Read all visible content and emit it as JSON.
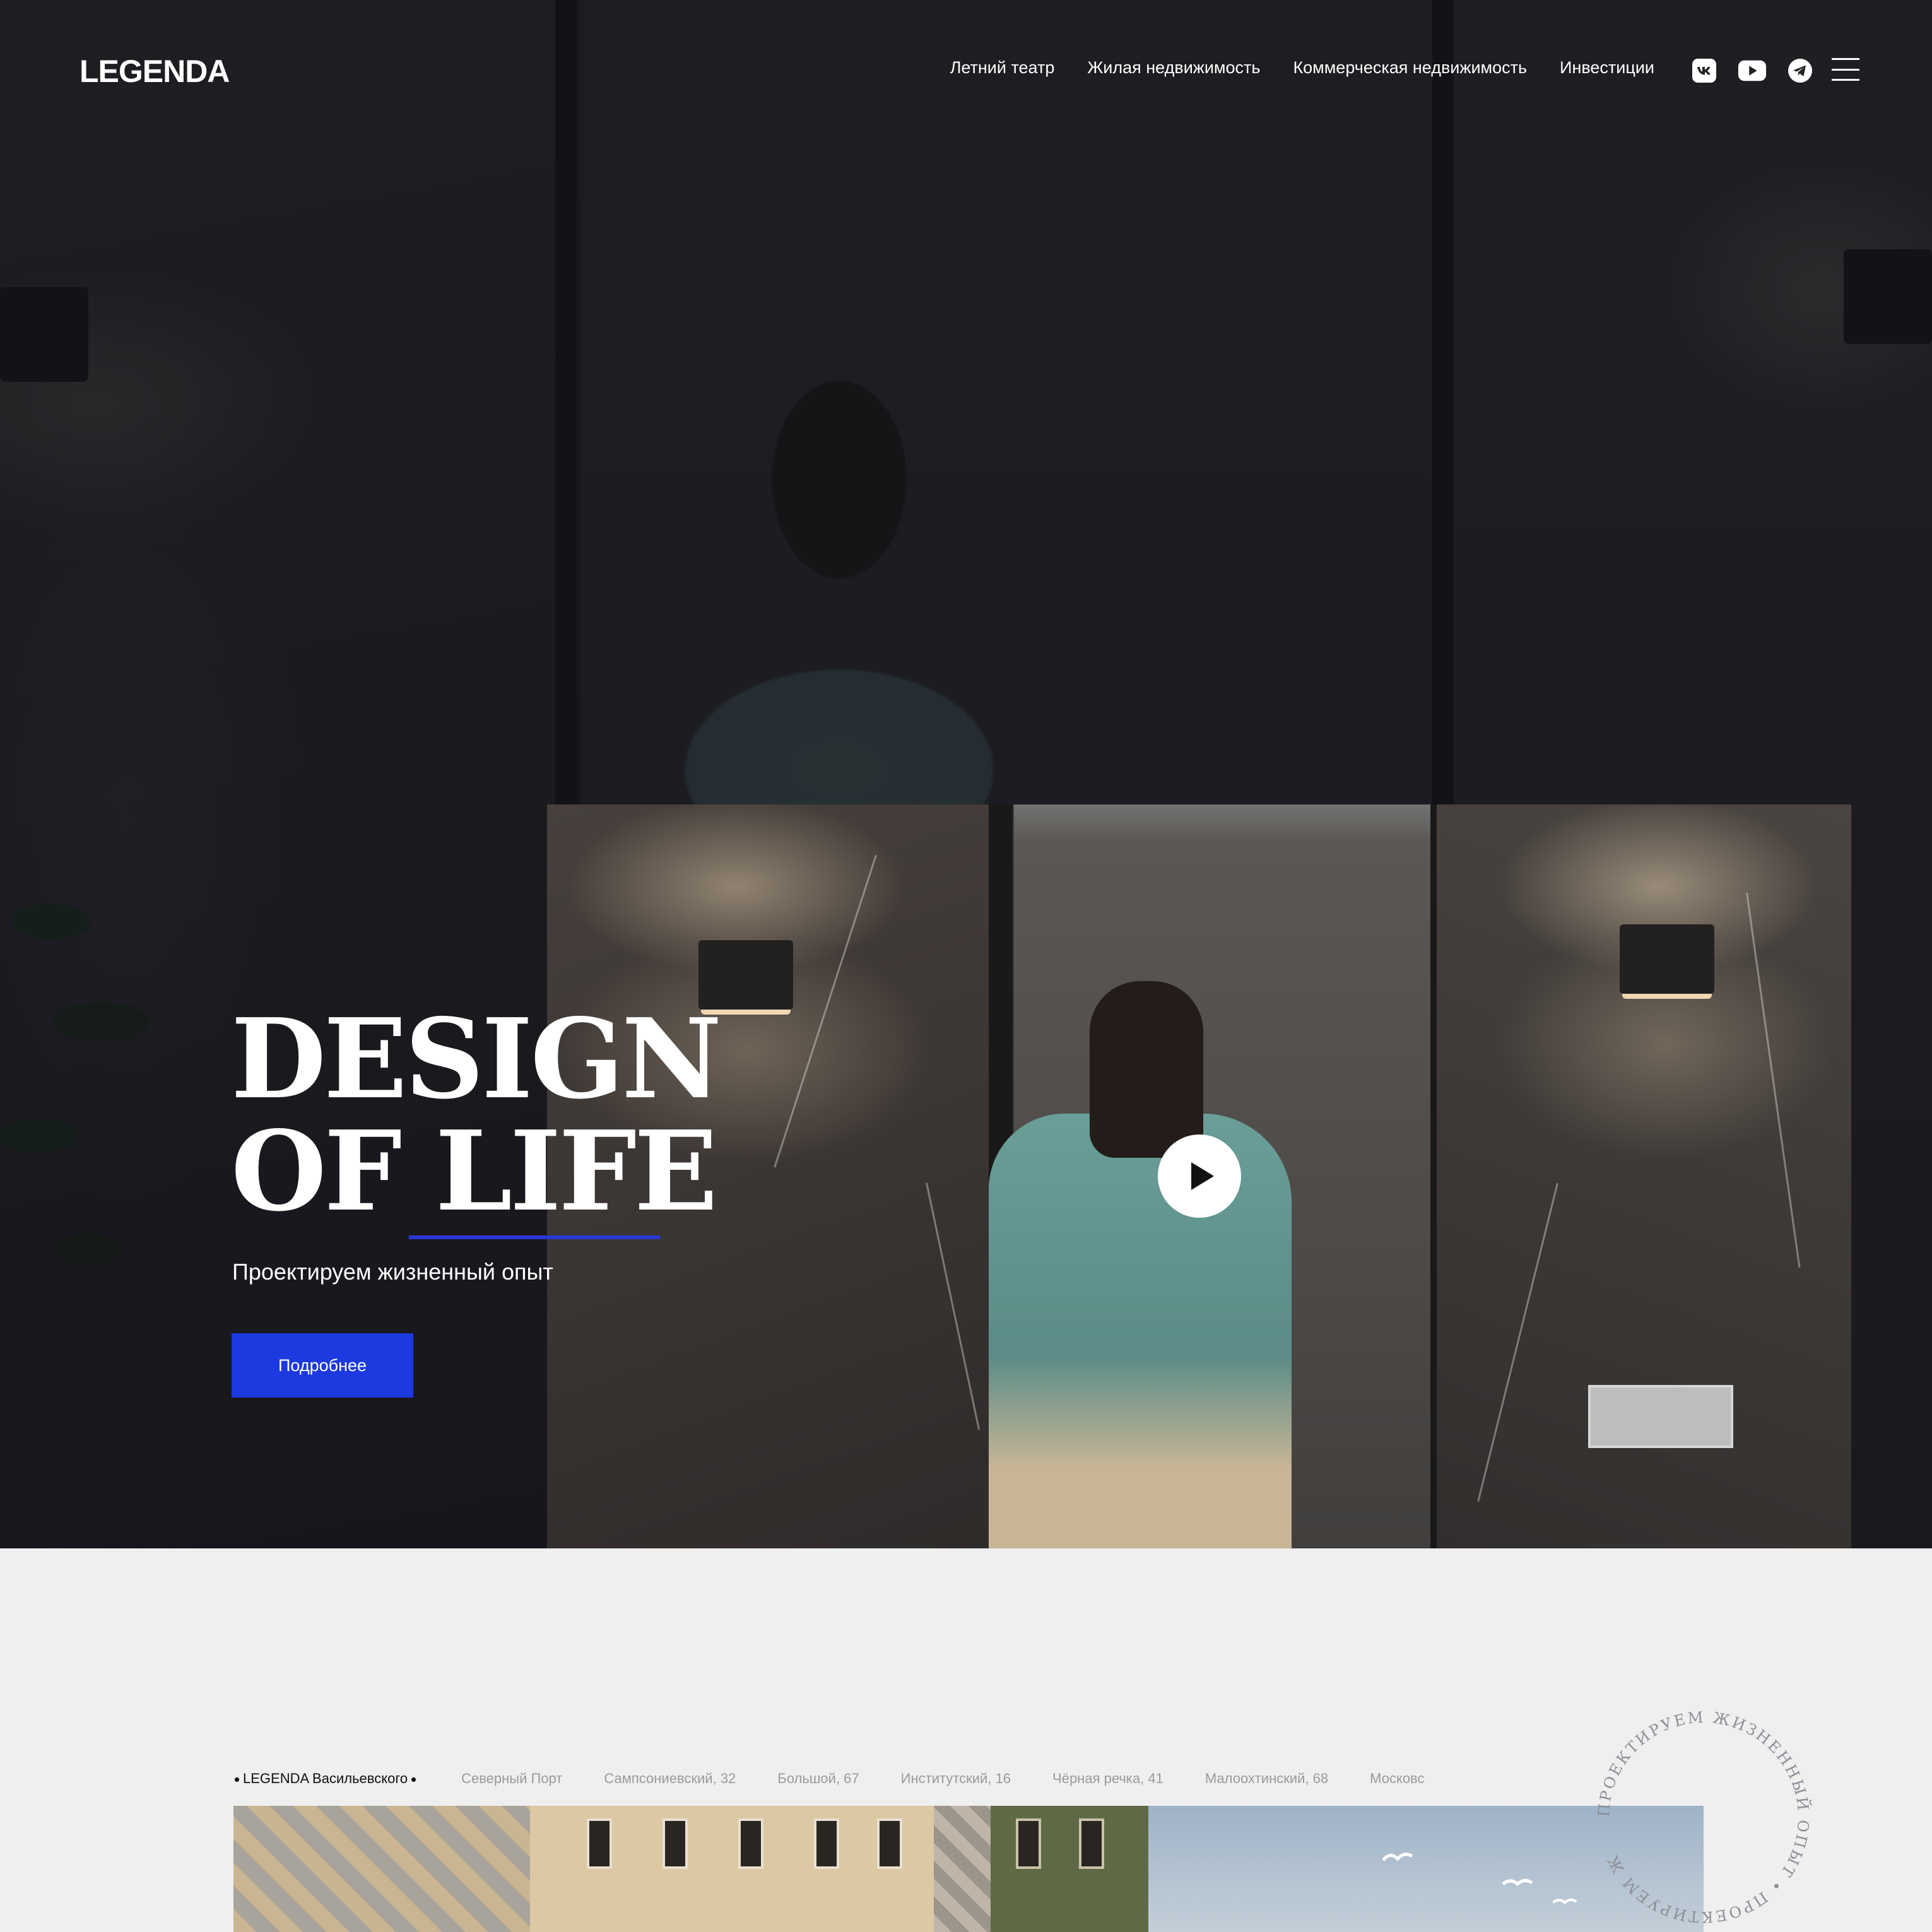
{
  "header": {
    "logo": "LEGENDA",
    "nav": [
      {
        "label": "Летний театр"
      },
      {
        "label": "Жилая недвижимость"
      },
      {
        "label": "Коммерческая недвижимость"
      },
      {
        "label": "Инвестиции"
      }
    ],
    "socials": [
      {
        "icon": "vk-icon"
      },
      {
        "icon": "youtube-icon"
      },
      {
        "icon": "telegram-icon"
      }
    ],
    "menu_icon": "burger-menu-icon"
  },
  "hero": {
    "headline_line1": "DESIGN",
    "headline_line2": "OF LIFE",
    "subtitle": "Проектируем жизненный опыт",
    "cta_label": "Подробнее",
    "accent_color": "#1d39e0",
    "play_icon": "play-icon"
  },
  "projects": {
    "tabs": [
      {
        "label": "LEGENDA Васильевского",
        "active": true
      },
      {
        "label": "Северный Порт",
        "active": false
      },
      {
        "label": "Сампсониевский, 32",
        "active": false
      },
      {
        "label": "Большой, 67",
        "active": false
      },
      {
        "label": "Институтский, 16",
        "active": false
      },
      {
        "label": "Чёрная речка, 41",
        "active": false
      },
      {
        "label": "Малоохтинский, 68",
        "active": false
      },
      {
        "label": "Московс",
        "active": false
      }
    ],
    "badge_text": "ПРОЕКТИРУЕМ ЖИЗНЕННЫЙ ОПЫТ • ПРОЕКТИРУЕМ Ж"
  }
}
